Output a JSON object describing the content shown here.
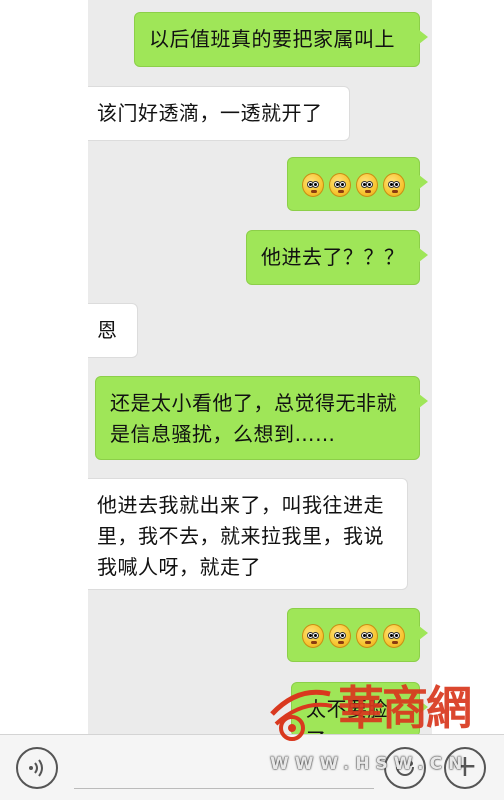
{
  "messages": [
    {
      "side": "out",
      "text": "以后值班真的要把家属叫上"
    },
    {
      "side": "in",
      "text": "该门好透滴，一透就开了"
    },
    {
      "side": "out",
      "emoji": "shocked-face-emoji",
      "emoji_count": 4
    },
    {
      "side": "out",
      "text": "他进去了？？？"
    },
    {
      "side": "in",
      "text": "恩"
    },
    {
      "side": "out",
      "text": "还是太小看他了，总觉得无非就是信息骚扰，么想到……"
    },
    {
      "side": "in",
      "text": "他进去我就出来了，叫我往进走里，我不去，就来拉我里，我说我喊人呀，就走了"
    },
    {
      "side": "out",
      "emoji": "shocked-face-emoji",
      "emoji_count": 4
    },
    {
      "side": "out",
      "text": "太不要脸了"
    }
  ],
  "input_bar": {
    "voice_icon": "voice-icon",
    "emoji_icon": "smiley-icon",
    "plus_icon": "plus-icon",
    "plus_glyph": "+"
  },
  "watermark": {
    "brand": "華商網",
    "url": "WWW.HSW.CN"
  },
  "colors": {
    "outgoing_bubble": "#9fe658",
    "incoming_bubble": "#ffffff",
    "chat_background": "#ebebeb",
    "watermark_red": "#d9381e"
  }
}
